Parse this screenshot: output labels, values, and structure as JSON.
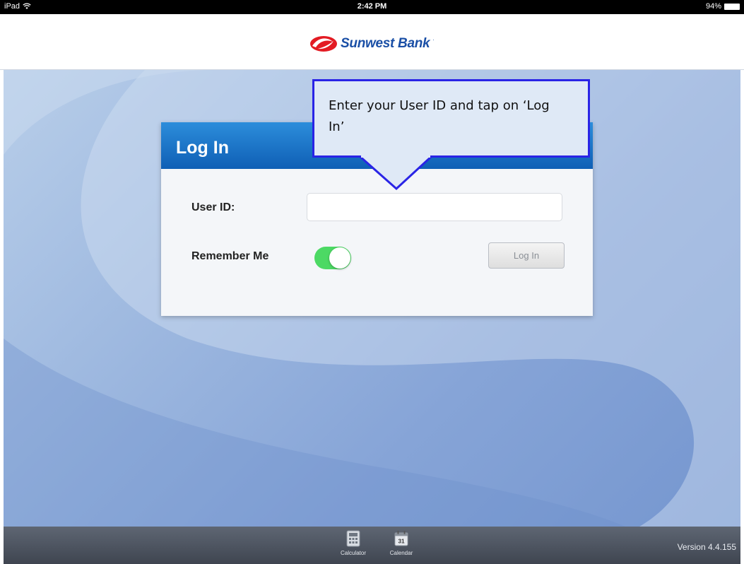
{
  "status_bar": {
    "device": "iPad",
    "time": "2:42 PM",
    "battery": "94%"
  },
  "header": {
    "logo_text": "Sunwest Bank",
    "logo_mark": "·"
  },
  "login_card": {
    "title": "Log In",
    "user_id_label": "User ID:",
    "user_id_value": "",
    "remember_label": "Remember Me",
    "remember_on": true,
    "login_button": "Log In"
  },
  "callout": {
    "text": "Enter your User ID and tap on ‘Log In’"
  },
  "toolbar": {
    "items": [
      {
        "label": "Calculator",
        "icon": "calculator-icon"
      },
      {
        "label": "Calendar",
        "icon": "calendar-icon",
        "icon_text": "31"
      }
    ],
    "version": "Version 4.4.155"
  },
  "colors": {
    "brand_blue": "#1a4fa6",
    "brand_red": "#e31b23",
    "toggle_green": "#4cd964",
    "callout_border": "#2a24e6"
  }
}
